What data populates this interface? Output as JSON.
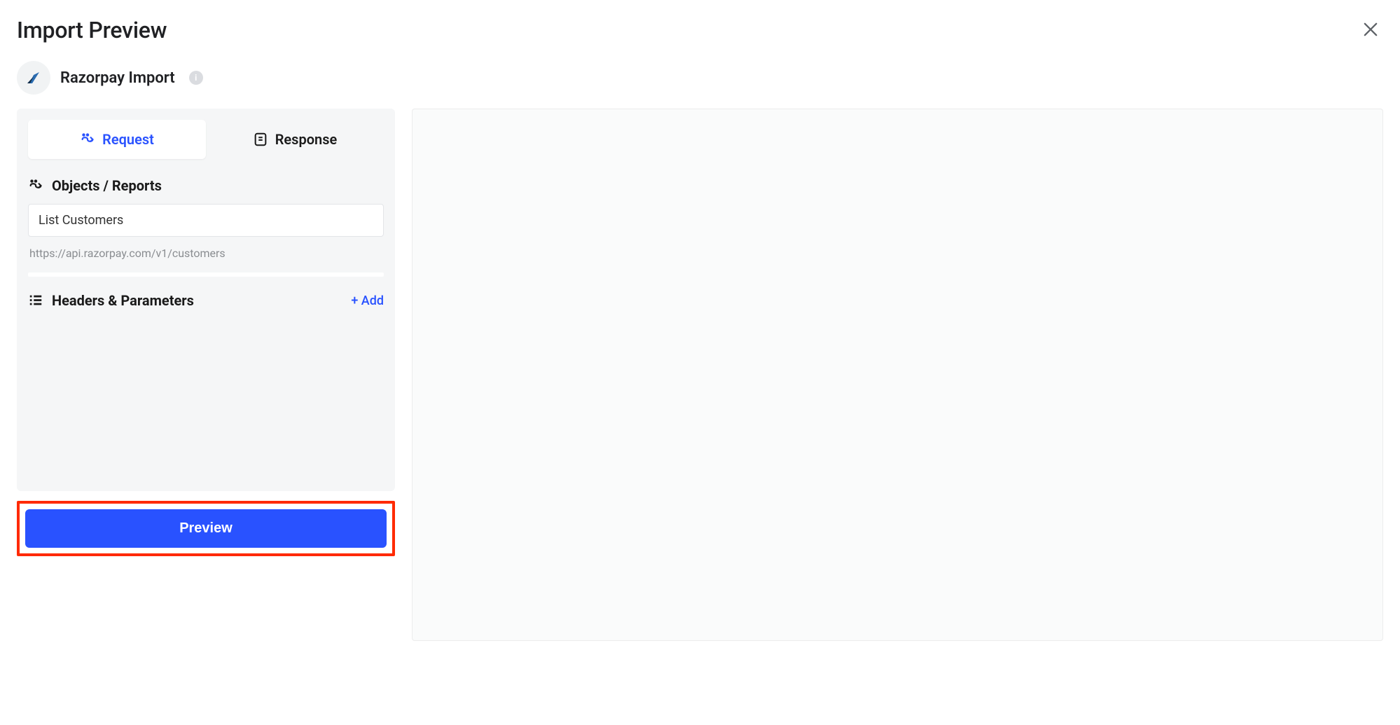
{
  "header": {
    "title": "Import Preview"
  },
  "source": {
    "name": "Razorpay Import",
    "info_glyph": "i"
  },
  "tabs": {
    "request": "Request",
    "response": "Response"
  },
  "objects": {
    "label": "Objects / Reports",
    "selected": "List Customers",
    "endpoint": "https://api.razorpay.com/v1/customers"
  },
  "headers_params": {
    "label": "Headers & Parameters",
    "add_label": "+ Add"
  },
  "actions": {
    "preview": "Preview"
  }
}
